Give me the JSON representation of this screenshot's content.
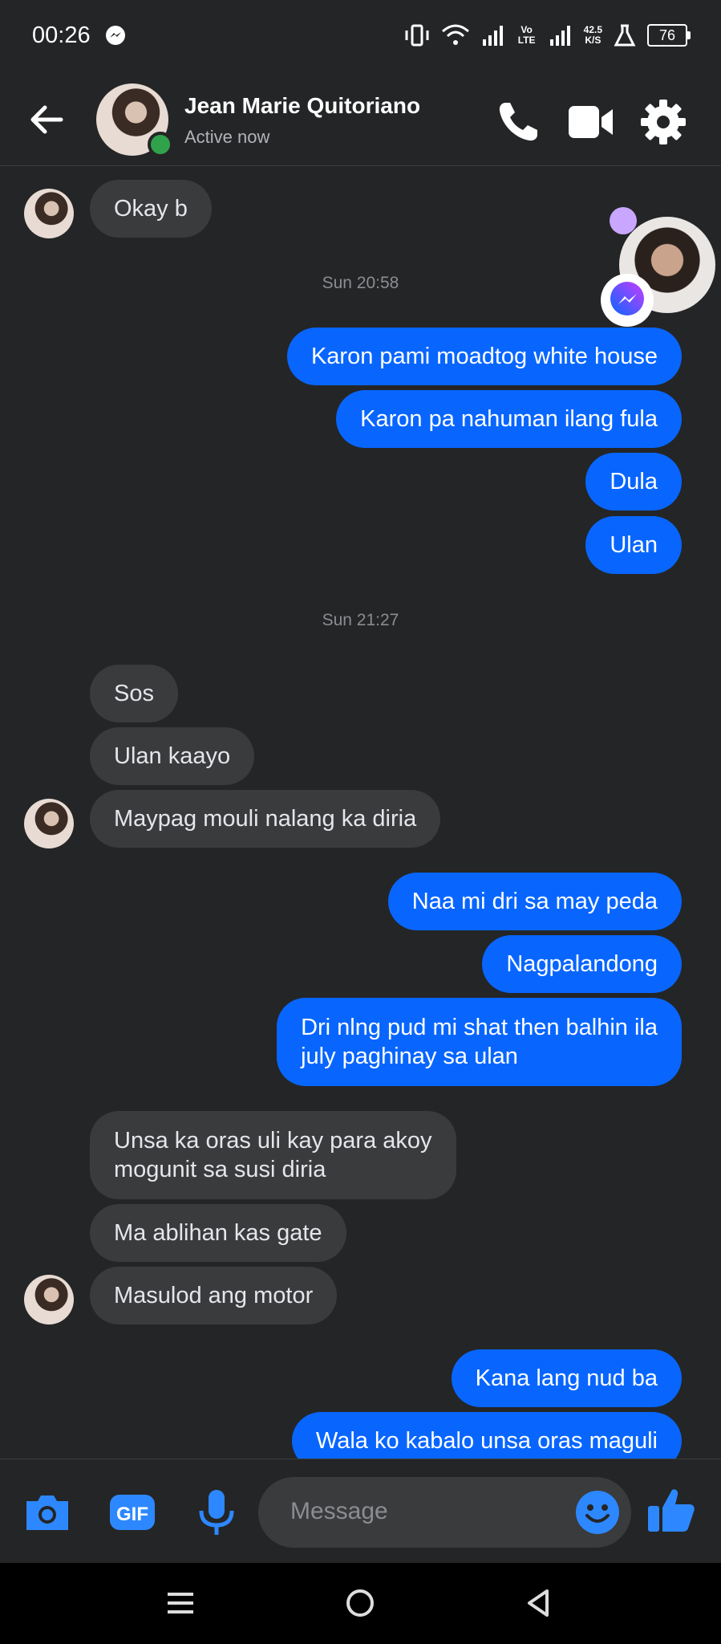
{
  "status_bar": {
    "time": "00:26",
    "speed_value": "42.5",
    "speed_unit": "K/S",
    "volte": "Vo LTE",
    "battery": "76"
  },
  "header": {
    "contact_name": "Jean Marie Quitoriano",
    "status": "Active now",
    "icons": [
      "back-arrow-icon",
      "phone-icon",
      "video-icon",
      "gear-icon"
    ],
    "accent": "#0866ff"
  },
  "messages": [
    {
      "dir": "in",
      "text": "Okay b"
    },
    {
      "type": "timestamp",
      "text": "Sun 20:58"
    },
    {
      "dir": "out",
      "text": "Karon pami moadtog white house"
    },
    {
      "dir": "out",
      "text": "Karon pa nahuman ilang fula"
    },
    {
      "dir": "out",
      "text": "Dula"
    },
    {
      "dir": "out",
      "text": "Ulan"
    },
    {
      "type": "timestamp",
      "text": "Sun 21:27"
    },
    {
      "dir": "in",
      "text": "Sos"
    },
    {
      "dir": "in",
      "text": "Ulan kaayo"
    },
    {
      "dir": "in",
      "text": "Maypag mouli nalang ka diria"
    },
    {
      "dir": "out",
      "text": "Naa mi dri sa may peda"
    },
    {
      "dir": "out",
      "text": "Nagpalandong"
    },
    {
      "dir": "out",
      "text": "Dri nlng pud mi shat then balhin ila\njuly paghinay sa ulan"
    },
    {
      "dir": "in",
      "text": "Unsa ka oras uli kay para akoy\nmogunit sa susi diria"
    },
    {
      "dir": "in",
      "text": "Ma ablihan kas gate"
    },
    {
      "dir": "in",
      "text": "Masulod ang motor"
    },
    {
      "dir": "out",
      "text": "Kana lang nud ba"
    },
    {
      "dir": "out",
      "text": "Wala ko kabalo unsa oras maguli"
    }
  ],
  "composer": {
    "placeholder": "Message",
    "icons": [
      "camera-icon",
      "gif-icon",
      "microphone-icon",
      "emoji-icon",
      "thumbs-up-icon"
    ]
  },
  "nav": {
    "icons": [
      "menu-icon",
      "home-icon",
      "back-triangle-icon"
    ]
  }
}
